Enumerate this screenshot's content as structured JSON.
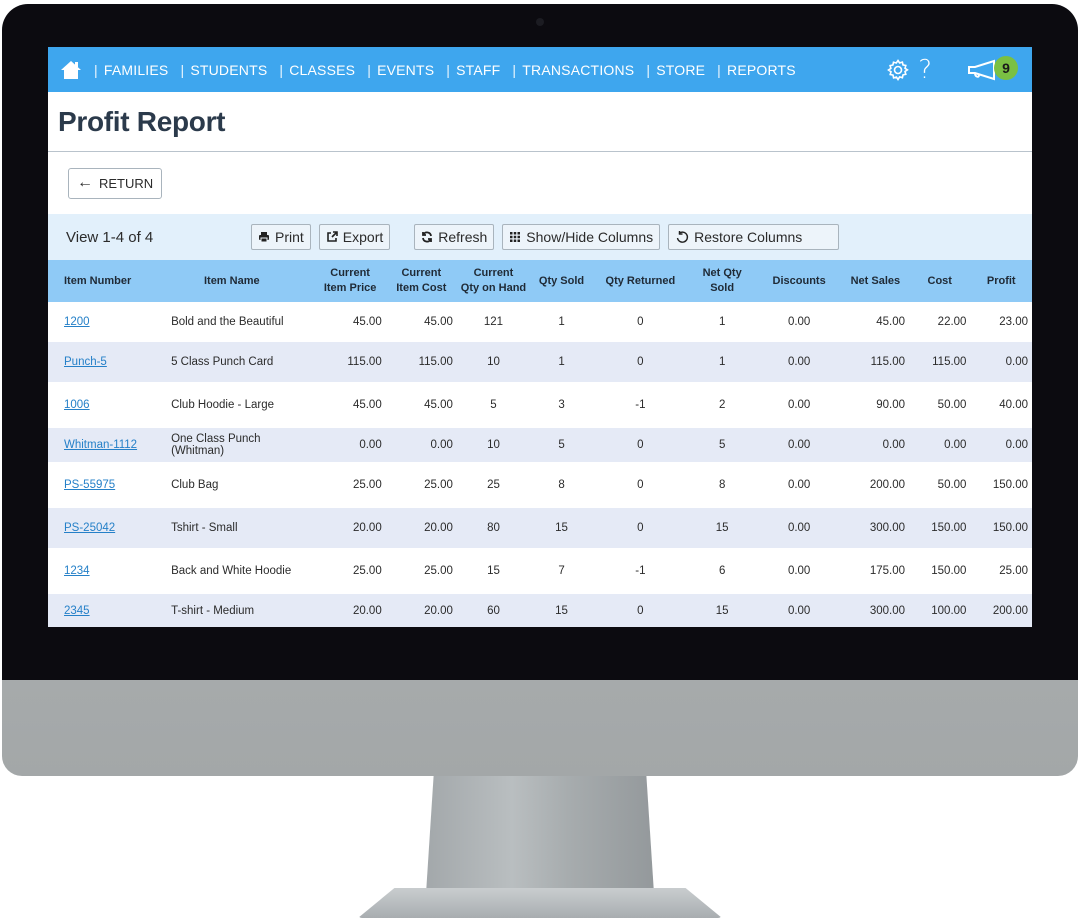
{
  "nav": {
    "items": [
      "FAMILIES",
      "STUDENTS",
      "CLASSES",
      "EVENTS",
      "STAFF",
      "TRANSACTIONS",
      "STORE",
      "REPORTS"
    ],
    "separator": "|",
    "help_label": "?",
    "notification_count": "9",
    "accent_color": "#3ea6ee",
    "badge_color": "#7ac043"
  },
  "page": {
    "title": "Profit Report",
    "return_label": "RETURN"
  },
  "toolbar": {
    "view_count": "View 1-4 of 4",
    "print_label": "Print",
    "export_label": "Export",
    "refresh_label": "Refresh",
    "show_hide_label": "Show/Hide Columns",
    "restore_label": "Restore Columns"
  },
  "table": {
    "headers": {
      "item_number": "Item Number",
      "item_name": "Item Name",
      "price_l1": "Current",
      "price_l2": "Item Price",
      "cost_l1": "Current",
      "cost_l2": "Item Cost",
      "qoh_l1": "Current",
      "qoh_l2": "Qty on Hand",
      "qty_sold": "Qty Sold",
      "qty_returned": "Qty Returned",
      "net_qty_sold": "Net Qty Sold",
      "discounts": "Discounts",
      "net_sales": "Net Sales",
      "cost": "Cost",
      "profit": "Profit"
    },
    "rows": [
      {
        "item_number": "1200",
        "item_name": "Bold and the Beautiful",
        "price": "45.00",
        "item_cost": "45.00",
        "qoh": "121",
        "qty_sold": "1",
        "qty_returned": "0",
        "net_qty_sold": "1",
        "discounts": "0.00",
        "net_sales": "45.00",
        "cost": "22.00",
        "profit": "23.00"
      },
      {
        "item_number": "Punch-5",
        "item_name": "5 Class Punch Card",
        "price": "115.00",
        "item_cost": "115.00",
        "qoh": "10",
        "qty_sold": "1",
        "qty_returned": "0",
        "net_qty_sold": "1",
        "discounts": "0.00",
        "net_sales": "115.00",
        "cost": "115.00",
        "profit": "0.00"
      },
      {
        "item_number": "1006",
        "item_name": "Club Hoodie - Large",
        "price": "45.00",
        "item_cost": "45.00",
        "qoh": "5",
        "qty_sold": "3",
        "qty_returned": "-1",
        "net_qty_sold": "2",
        "discounts": "0.00",
        "net_sales": "90.00",
        "cost": "50.00",
        "profit": "40.00"
      },
      {
        "item_number": "Whitman-1112",
        "item_name": "One Class Punch (Whitman)",
        "price": "0.00",
        "item_cost": "0.00",
        "qoh": "10",
        "qty_sold": "5",
        "qty_returned": "0",
        "net_qty_sold": "5",
        "discounts": "0.00",
        "net_sales": "0.00",
        "cost": "0.00",
        "profit": "0.00"
      },
      {
        "item_number": "PS-55975",
        "item_name": "Club Bag",
        "price": "25.00",
        "item_cost": "25.00",
        "qoh": "25",
        "qty_sold": "8",
        "qty_returned": "0",
        "net_qty_sold": "8",
        "discounts": "0.00",
        "net_sales": "200.00",
        "cost": "50.00",
        "profit": "150.00"
      },
      {
        "item_number": "PS-25042",
        "item_name": "Tshirt - Small",
        "price": "20.00",
        "item_cost": "20.00",
        "qoh": "80",
        "qty_sold": "15",
        "qty_returned": "0",
        "net_qty_sold": "15",
        "discounts": "0.00",
        "net_sales": "300.00",
        "cost": "150.00",
        "profit": "150.00"
      },
      {
        "item_number": "1234",
        "item_name": "Back and White Hoodie",
        "price": "25.00",
        "item_cost": "25.00",
        "qoh": "15",
        "qty_sold": "7",
        "qty_returned": "-1",
        "net_qty_sold": "6",
        "discounts": "0.00",
        "net_sales": "175.00",
        "cost": "150.00",
        "profit": "25.00"
      },
      {
        "item_number": "2345",
        "item_name": "T-shirt - Medium",
        "price": "20.00",
        "item_cost": "20.00",
        "qoh": "60",
        "qty_sold": "15",
        "qty_returned": "0",
        "net_qty_sold": "15",
        "discounts": "0.00",
        "net_sales": "300.00",
        "cost": "100.00",
        "profit": "200.00"
      }
    ]
  }
}
